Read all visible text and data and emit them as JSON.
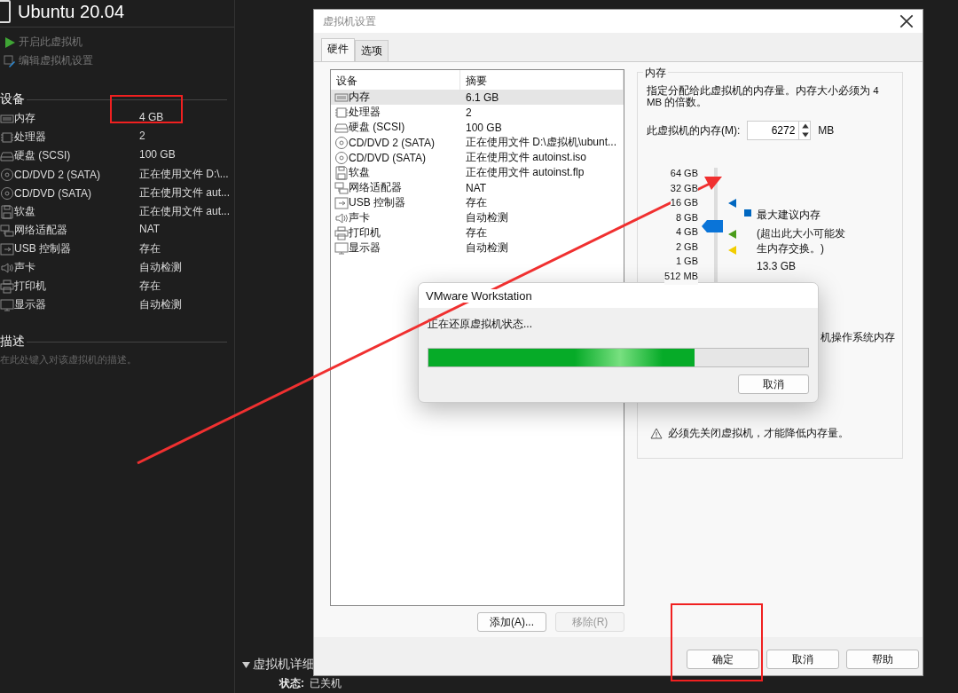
{
  "vm_panel": {
    "title": "Ubuntu 20.04",
    "actions": [
      {
        "label": "开启此虚拟机",
        "kind": "power"
      },
      {
        "label": "编辑虚拟机设置",
        "kind": "edit"
      }
    ],
    "devices_heading": "设备",
    "devices": [
      {
        "name": "内存",
        "summary": "4 GB",
        "kind": "memory"
      },
      {
        "name": "处理器",
        "summary": "2",
        "kind": "cpu"
      },
      {
        "name": "硬盘 (SCSI)",
        "summary": "100 GB",
        "kind": "disk"
      },
      {
        "name": "CD/DVD 2 (SATA)",
        "summary": "正在使用文件 D:\\...",
        "kind": "cd"
      },
      {
        "name": "CD/DVD (SATA)",
        "summary": "正在使用文件 aut...",
        "kind": "cd"
      },
      {
        "name": "软盘",
        "summary": "正在使用文件 aut...",
        "kind": "floppy"
      },
      {
        "name": "网络适配器",
        "summary": "NAT",
        "kind": "network"
      },
      {
        "name": "USB 控制器",
        "summary": "存在",
        "kind": "usb"
      },
      {
        "name": "声卡",
        "summary": "自动检测",
        "kind": "sound"
      },
      {
        "name": "打印机",
        "summary": "存在",
        "kind": "printer"
      },
      {
        "name": "显示器",
        "summary": "自动检测",
        "kind": "monitor"
      }
    ],
    "description_heading": "描述",
    "description_placeholder": "在此处键入对该虚拟机的描述。",
    "details_heading": "虚拟机详细",
    "details": [
      {
        "label": "状态:",
        "value": "已关机"
      }
    ]
  },
  "settings_dialog": {
    "title": "虚拟机设置",
    "tabs": [
      {
        "label": "硬件",
        "selected": true
      },
      {
        "label": "选项",
        "selected": false
      }
    ],
    "columns": [
      "设备",
      "摘要"
    ],
    "devices": [
      {
        "name": "内存",
        "summary": "6.1 GB",
        "kind": "memory",
        "selected": true
      },
      {
        "name": "处理器",
        "summary": "2",
        "kind": "cpu",
        "selected": false
      },
      {
        "name": "硬盘 (SCSI)",
        "summary": "100 GB",
        "kind": "disk",
        "selected": false
      },
      {
        "name": "CD/DVD 2 (SATA)",
        "summary": "正在使用文件 D:\\虚拟机\\ubunt...",
        "kind": "cd",
        "selected": false
      },
      {
        "name": "CD/DVD (SATA)",
        "summary": "正在使用文件 autoinst.iso",
        "kind": "cd",
        "selected": false
      },
      {
        "name": "软盘",
        "summary": "正在使用文件 autoinst.flp",
        "kind": "floppy",
        "selected": false
      },
      {
        "name": "网络适配器",
        "summary": "NAT",
        "kind": "network",
        "selected": false
      },
      {
        "name": "USB 控制器",
        "summary": "存在",
        "kind": "usb",
        "selected": false
      },
      {
        "name": "声卡",
        "summary": "自动检测",
        "kind": "sound",
        "selected": false
      },
      {
        "name": "打印机",
        "summary": "存在",
        "kind": "printer",
        "selected": false
      },
      {
        "name": "显示器",
        "summary": "自动检测",
        "kind": "monitor",
        "selected": false
      }
    ],
    "add_button": {
      "label": "添加(A)...",
      "disabled": false
    },
    "remove_button": {
      "label": "移除(R)",
      "disabled": true
    },
    "memory": {
      "heading": "内存",
      "description": "指定分配给此虚拟机的内存量。内存大小必须为 4 MB 的倍数。",
      "field_label": "此虚拟机的内存(M):",
      "value": "6272",
      "unit": "MB",
      "scale": [
        "64 GB",
        "32 GB",
        "16 GB",
        "8 GB",
        "4 GB",
        "2 GB",
        "1 GB",
        "512 MB"
      ],
      "level": 0.75,
      "markers": [
        {
          "kind": "max",
          "color": "#0067c0"
        },
        {
          "kind": "recommended",
          "color": "#4a9c1a"
        },
        {
          "kind": "minimum",
          "color": "#f2cd00"
        }
      ],
      "legend": [
        {
          "color": "#0067c0",
          "title": "最大建议内存",
          "note": "(超出此大小可能发生内存交换。)",
          "value": "13.3 GB"
        }
      ],
      "partial_text": "机操作系统内存",
      "warning": "必须先关闭虚拟机，才能降低内存量。"
    },
    "buttons": [
      {
        "label": "确定"
      },
      {
        "label": "取消"
      },
      {
        "label": "帮助"
      }
    ]
  },
  "progress_dialog": {
    "title": "VMware Workstation",
    "message": "正在还原虚拟机状态...",
    "level": 0.7,
    "button": "取消"
  }
}
